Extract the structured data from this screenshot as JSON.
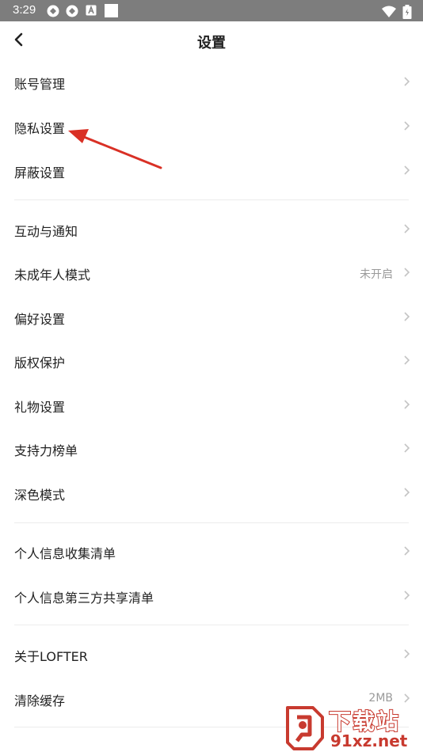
{
  "status_bar": {
    "time": "3:29"
  },
  "header": {
    "title": "设置"
  },
  "groups": [
    {
      "items": [
        {
          "label": "账号管理",
          "value": ""
        },
        {
          "label": "隐私设置",
          "value": ""
        },
        {
          "label": "屏蔽设置",
          "value": ""
        }
      ]
    },
    {
      "items": [
        {
          "label": "互动与通知",
          "value": ""
        },
        {
          "label": "未成年人模式",
          "value": "未开启"
        },
        {
          "label": "偏好设置",
          "value": ""
        },
        {
          "label": "版权保护",
          "value": ""
        },
        {
          "label": "礼物设置",
          "value": ""
        },
        {
          "label": "支持力榜单",
          "value": ""
        },
        {
          "label": "深色模式",
          "value": ""
        }
      ]
    },
    {
      "items": [
        {
          "label": "个人信息收集清单",
          "value": ""
        },
        {
          "label": "个人信息第三方共享清单",
          "value": ""
        }
      ]
    },
    {
      "items": [
        {
          "label": "关于LOFTER",
          "value": ""
        },
        {
          "label": "清除缓存",
          "value": "2MB"
        }
      ]
    }
  ],
  "colors": {
    "accent_arrow": "#d93025",
    "chevron": "#c4c4c4",
    "watermark": "#c83a2f",
    "statusbar": "#7d7d7d"
  },
  "icons": [
    "back-arrow-icon",
    "chevron-right-icon",
    "wifi-icon",
    "battery-icon"
  ],
  "watermark": {
    "title": "下载站",
    "domain": "91xz.net"
  }
}
